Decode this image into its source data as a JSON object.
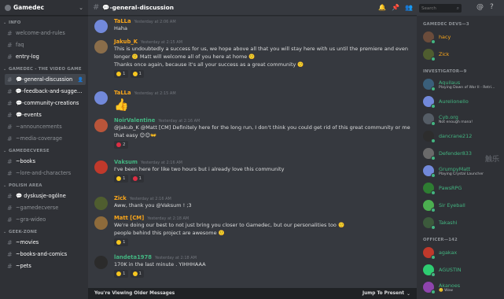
{
  "sidebar": {
    "guild_name": "Gamedec",
    "categories": [
      {
        "label": "INFO",
        "channels": [
          {
            "name": "welcome-and-rules",
            "state": "normal"
          },
          {
            "name": "faq",
            "state": "normal"
          },
          {
            "name": "entry-log",
            "state": "unread"
          }
        ]
      },
      {
        "label": "GAMEDEC - THE VIDEO GAME",
        "channels": [
          {
            "name": "💬-general-discussion",
            "state": "active"
          },
          {
            "name": "💬-feedback-and-sugges...",
            "state": "unread"
          },
          {
            "name": "💬-community-creations",
            "state": "unread"
          },
          {
            "name": "💬-events",
            "state": "unread"
          },
          {
            "name": "~announcements",
            "state": "normal"
          },
          {
            "name": "~media-coverage",
            "state": "normal"
          }
        ]
      },
      {
        "label": "GAMEDECVERSE",
        "channels": [
          {
            "name": "~books",
            "state": "unread"
          },
          {
            "name": "~lore-and-characters",
            "state": "normal"
          }
        ]
      },
      {
        "label": "POLISH AREA",
        "channels": [
          {
            "name": "💬 dyskusje-ogólne",
            "state": "unread"
          },
          {
            "name": "~gamedecverse",
            "state": "normal"
          },
          {
            "name": "~gra-wideo",
            "state": "normal"
          }
        ]
      },
      {
        "label": "GEEK-ZONE",
        "channels": [
          {
            "name": "~movies",
            "state": "unread"
          },
          {
            "name": "~books-and-comics",
            "state": "unread"
          },
          {
            "name": "~pets",
            "state": "unread"
          }
        ]
      }
    ]
  },
  "header": {
    "channel_name": "💬-general-discussion",
    "search_placeholder": "Search"
  },
  "messages": [
    {
      "user": "TaLLa",
      "color": "#faa61a",
      "avatar": "#7289da",
      "time": "Yesterday at 2:06 AM",
      "lines": [
        "Haha"
      ],
      "reactions": []
    },
    {
      "user": "Jakub_K",
      "color": "#faa61a",
      "avatar": "#8a6d4a",
      "time": "Yesterday at 2:15 AM",
      "lines": [
        "This is undoubtedly a success for us, we hope above all that you will stay here with us until the premiere and even",
        "longer 🙂 Matt will welcome all of you here at home 🙂",
        "Thanks once again, because it's all your success as a great community 🙂"
      ],
      "reactions": [
        {
          "count": "1",
          "color": "#f8c71f"
        },
        {
          "count": "1",
          "color": "#f8c71f"
        }
      ]
    },
    {
      "user": "TaLLa",
      "color": "#faa61a",
      "avatar": "#7289da",
      "time": "Yesterday at 2:15 AM",
      "lines": [
        "👍"
      ],
      "reactions": []
    },
    {
      "user": "NoirValentine",
      "color": "#43b581",
      "avatar": "#b9553a",
      "time": "Yesterday at 2:16 AM",
      "lines": [
        "@Jakub_K @Matt [CM] Definitely here for the long run, I don't think you could get rid of this great community or me",
        "that easy 😊😊👐"
      ],
      "reactions": [
        {
          "count": "2",
          "color": "#dd2e44"
        }
      ]
    },
    {
      "user": "Vaksum",
      "color": "#43b581",
      "avatar": "#c0392b",
      "time": "Yesterday at 2:16 AM",
      "lines": [
        "I've been here for like two hours but i already love this community"
      ],
      "reactions": [
        {
          "count": "1",
          "color": "#f8c71f"
        },
        {
          "count": "1",
          "color": "#dd2e44"
        }
      ]
    },
    {
      "user": "Zick",
      "color": "#faa61a",
      "avatar": "#4f5d2f",
      "time": "Yesterday at 2:16 AM",
      "lines": [
        "Aww, thank you @Vaksum ! ;3"
      ],
      "reactions": []
    },
    {
      "user": "Matt [CM]",
      "color": "#faa61a",
      "avatar": "#8e6b3b",
      "time": "Yesterday at 2:18 AM",
      "lines": [
        "We're doing our best to not just bring you closer to Gamedec, but our personalities too 🙂",
        "people behind this project are awesome 🙂"
      ],
      "reactions": [
        {
          "count": "1",
          "color": "#f8c71f"
        }
      ]
    },
    {
      "user": "landeta1978",
      "color": "#43b581",
      "avatar": "#2b2b2b",
      "time": "Yesterday at 2:18 AM",
      "lines": [
        "170K in the last minute . YIHHHAAA"
      ],
      "reactions": [
        {
          "count": "1",
          "color": "#f8c71f"
        },
        {
          "count": "1",
          "color": "#f8c71f"
        }
      ]
    }
  ],
  "older_bar": {
    "label": "You're Viewing Older Messages",
    "jump": "Jump To Present"
  },
  "members": {
    "groups": [
      {
        "label": "GAMEDEC DEVS—3",
        "items": [
          {
            "name": "hacy",
            "color": "#faa61a",
            "avatar": "#6b4c3b",
            "status": "#43b581",
            "activity": ""
          },
          {
            "name": "Zick",
            "color": "#faa61a",
            "avatar": "#4f5d2f",
            "status": "#43b581",
            "activity": ""
          }
        ]
      },
      {
        "label": "INVESTIGATOR—9",
        "items": [
          {
            "name": "Aquilaus",
            "color": "#43b581",
            "avatar": "#3a5f7a",
            "status": "#43b581",
            "activity": "Playing Dawn of War II - Retri..."
          },
          {
            "name": "Aurelionello",
            "color": "#43b581",
            "avatar": "#7289da",
            "status": "#43b581",
            "activity": ""
          },
          {
            "name": "Cyb.org",
            "color": "#43b581",
            "avatar": "#555d66",
            "status": "#43b581",
            "activity": "Not enough mana!"
          },
          {
            "name": "dancrane212",
            "color": "#43b581",
            "avatar": "#2d2d2d",
            "status": "#43b581",
            "activity": ""
          },
          {
            "name": "Defender833",
            "color": "#43b581",
            "avatar": "#6a6a6a",
            "status": "#43b581",
            "activity": ""
          },
          {
            "name": "GrumpyMatt",
            "color": "#43b581",
            "avatar": "#7289da",
            "status": "#43b581",
            "activity": "Playing Crystal Launcher"
          },
          {
            "name": "PawsRPG",
            "color": "#43b581",
            "avatar": "#2e7d32",
            "status": "#43b581",
            "activity": ""
          },
          {
            "name": "Sir Eyeball",
            "color": "#43b581",
            "avatar": "#4caf50",
            "status": "#43b581",
            "activity": ""
          },
          {
            "name": "Takashi",
            "color": "#43b581",
            "avatar": "#3c5a3c",
            "status": "#43b581",
            "activity": ""
          }
        ]
      },
      {
        "label": "OFFICER—142",
        "items": [
          {
            "name": "agakax",
            "color": "#43b581",
            "avatar": "#c0392b",
            "status": "#43b581",
            "activity": ""
          },
          {
            "name": "AGUSTIN",
            "color": "#43b581",
            "avatar": "#2ecc71",
            "status": "#43b581",
            "activity": ""
          },
          {
            "name": "Akanoes",
            "color": "#43b581",
            "avatar": "#8e44ad",
            "status": "#43b581",
            "activity": "🙂 Wow"
          },
          {
            "name": "Alexandros",
            "color": "#43b581",
            "avatar": "#2980b9",
            "status": "#43b581",
            "activity": ""
          }
        ]
      }
    ]
  },
  "watermark": "触乐"
}
